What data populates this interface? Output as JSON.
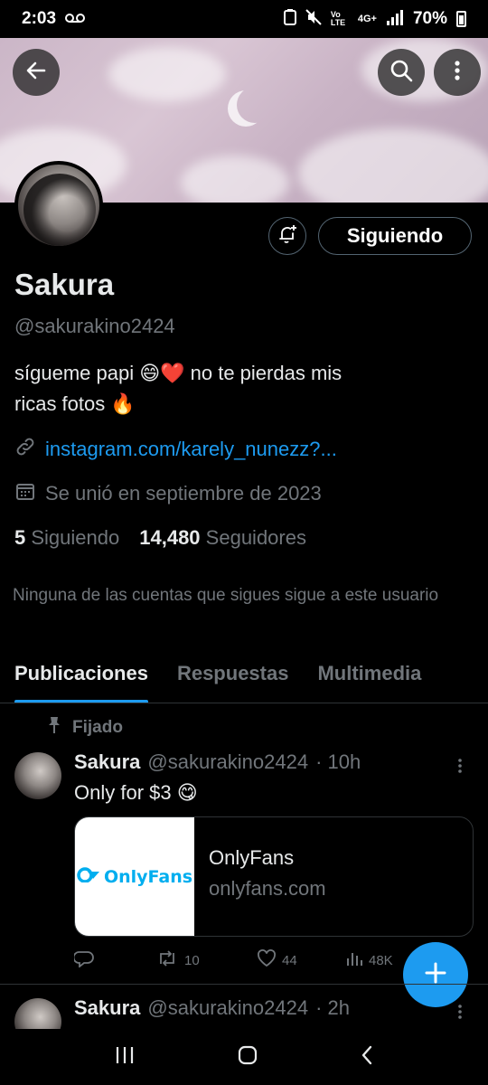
{
  "status": {
    "time": "2:03",
    "battery": "70%",
    "network": "4G+",
    "volte": "Vo LTE"
  },
  "profile": {
    "display_name": "Sakura",
    "handle": "@sakurakino2424",
    "bio_line1": "sígueme papi 😄❤️ no te pierdas mis",
    "bio_line2": "ricas fotos 🔥",
    "link": "instagram.com/karely_nunezz?...",
    "joined": "Se unió en septiembre de 2023",
    "following_count": "5",
    "following_label": "Siguiendo",
    "followers_count": "14,480",
    "followers_label": "Seguidores",
    "mutuals_notice": "Ninguna de las cuentas que sigues sigue a este usuario"
  },
  "buttons": {
    "following": "Siguiendo"
  },
  "tabs": [
    {
      "label": "Publicaciones",
      "active": true
    },
    {
      "label": "Respuestas",
      "active": false
    },
    {
      "label": "Multimedia",
      "active": false
    }
  ],
  "pinned_label": "Fijado",
  "posts": [
    {
      "name": "Sakura",
      "handle": "@sakurakino2424",
      "time": "· 10h",
      "text": "Only for $3 😋",
      "card": {
        "thumb_text": "OnlyFans",
        "title": "OnlyFans",
        "domain": "onlyfans.com"
      },
      "stats": {
        "replies": "",
        "reposts": "10",
        "likes": "44",
        "views": "48K"
      }
    },
    {
      "name": "Sakura",
      "handle": "@sakurakino2424",
      "time": "· 2h"
    }
  ],
  "colors": {
    "accent": "#1d9bf0",
    "background": "#000000",
    "muted": "#71767b",
    "border": "#2f3336"
  },
  "icons": [
    "back-arrow-icon",
    "search-icon",
    "more-vertical-icon",
    "bell-plus-icon",
    "link-icon",
    "calendar-icon",
    "pin-icon",
    "reply-icon",
    "repost-icon",
    "like-icon",
    "views-icon",
    "plus-icon"
  ]
}
